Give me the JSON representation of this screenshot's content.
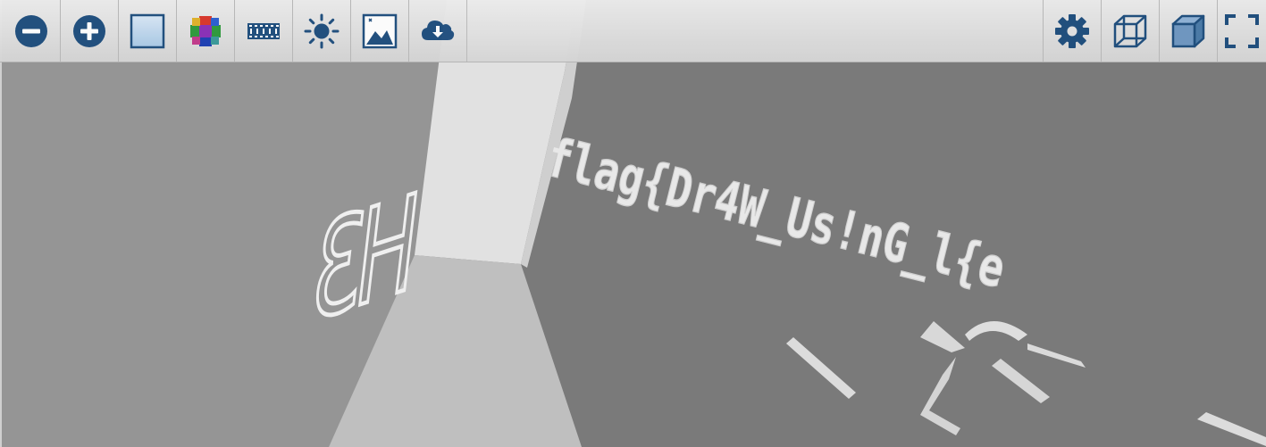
{
  "viewer": {
    "scene_text": {
      "left_wall": "ƐH",
      "right_wall": "flag{Dr4W_Us!nG_l{e"
    }
  },
  "toolbar": {
    "left": [
      {
        "name": "zoom-out-button",
        "icon": "minus-circle-icon"
      },
      {
        "name": "zoom-in-button",
        "icon": "plus-circle-icon"
      },
      {
        "name": "plain-background-button",
        "icon": "square-icon"
      },
      {
        "name": "color-mode-button",
        "icon": "color-cross-icon"
      },
      {
        "name": "film-strip-button",
        "icon": "film-icon"
      },
      {
        "name": "lighting-button",
        "icon": "sun-icon"
      },
      {
        "name": "image-button",
        "icon": "image-icon"
      },
      {
        "name": "download-button",
        "icon": "cloud-download-icon"
      }
    ],
    "right": [
      {
        "name": "settings-button",
        "icon": "gear-icon"
      },
      {
        "name": "wireframe-button",
        "icon": "wireframe-cube-icon"
      },
      {
        "name": "solid-view-button",
        "icon": "solid-cube-icon"
      },
      {
        "name": "fullscreen-button",
        "icon": "fullscreen-icon"
      }
    ]
  },
  "colors": {
    "icon": "#1f4e7e",
    "toolbar_bg": "#dcdcdc",
    "left_wall": "#959595",
    "right_wall": "#7a7a7a",
    "floor": "#bfbfbf",
    "pillar": "#e0e0e0",
    "text_emboss": "#ececec"
  }
}
